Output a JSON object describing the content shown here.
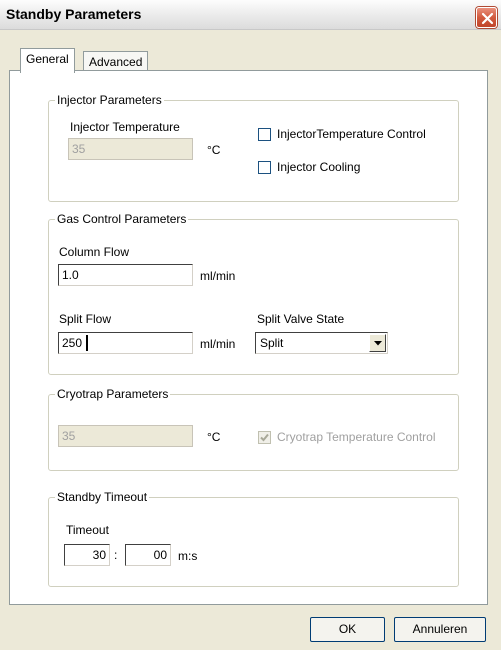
{
  "window": {
    "title": "Standby Parameters"
  },
  "tabs": [
    {
      "label": "General",
      "active": true
    },
    {
      "label": "Advanced",
      "active": false
    }
  ],
  "injector": {
    "group_title": "Injector Parameters",
    "temperature_label": "Injector Temperature",
    "temperature_value": "35",
    "temperature_unit": "°C",
    "temp_control_label": "InjectorTemperature Control",
    "temp_control_checked": false,
    "cooling_label": "Injector Cooling",
    "cooling_checked": false
  },
  "gas": {
    "group_title": "Gas Control Parameters",
    "column_flow_label": "Column Flow",
    "column_flow_value": "1.0",
    "column_flow_unit": "ml/min",
    "split_flow_label": "Split Flow",
    "split_flow_value": "250",
    "split_flow_unit": "ml/min",
    "split_valve_label": "Split Valve State",
    "split_valve_value": "Split"
  },
  "cryotrap": {
    "group_title": "Cryotrap Parameters",
    "temperature_value": "35",
    "temperature_unit": "°C",
    "temp_control_label": "Cryotrap Temperature Control",
    "temp_control_checked": true
  },
  "standby": {
    "group_title": "Standby Timeout",
    "timeout_label": "Timeout",
    "minutes_value": "30",
    "separator": ":",
    "seconds_value": "00",
    "unit": "m:s"
  },
  "buttons": {
    "ok_label": "OK",
    "cancel_label": "Annuleren"
  },
  "colors": {
    "close_button": "#d25a3e",
    "dialog_background": "#ece9d8",
    "panel_background": "#ffffff",
    "disabled_text": "#a0a0a0"
  }
}
